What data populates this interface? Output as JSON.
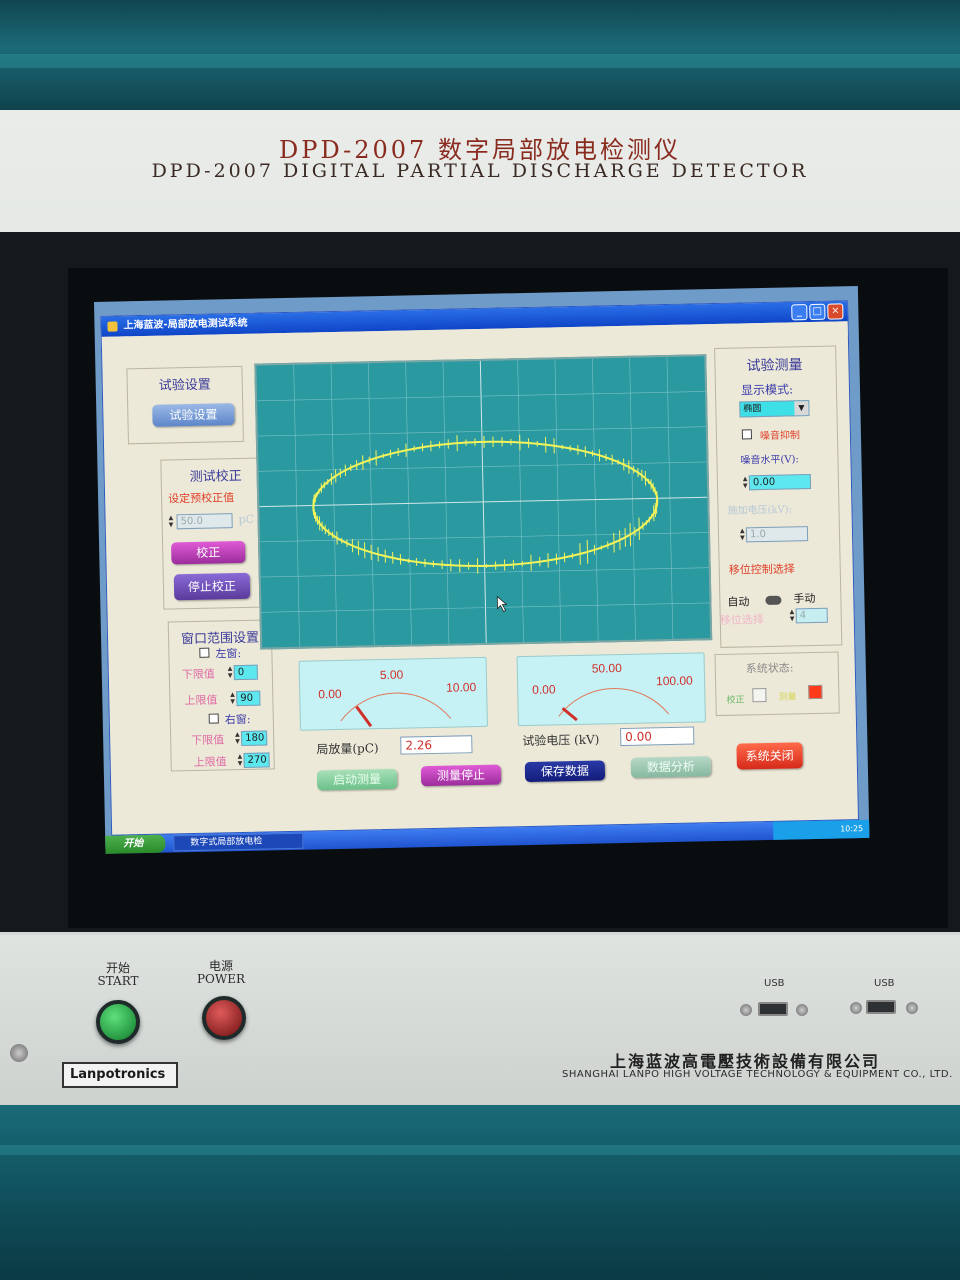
{
  "device": {
    "title_cn": "DPD-2007 数字局部放电检测仪",
    "title_en": "DPD-2007 DIGITAL PARTIAL DISCHARGE DETECTOR",
    "start_label_cn": "开始",
    "start_label_en": "START",
    "power_label_cn": "电源",
    "power_label_en": "POWER",
    "usb1": "USB",
    "usb2": "USB",
    "logo": "Lanpotronics",
    "company_cn": "上海蓝波高電壓技術設備有限公司",
    "company_en": "SHANGHAI LANPO HIGH VOLTAGE TECHNOLOGY & EQUIPMENT CO., LTD."
  },
  "window": {
    "title": "上海蓝波-局部放电测试系统"
  },
  "test_setup": {
    "title": "试验设置",
    "button": "试验设置"
  },
  "calibration": {
    "title": "测试校正",
    "preset_label": "设定预校正值",
    "preset_value": "50.0",
    "unit": "pC",
    "calibrate_button": "校正",
    "stop_button": "停止校正"
  },
  "window_range": {
    "title": "窗口范围设置",
    "left_window": "左窗:",
    "right_window": "右窗:",
    "lower_label": "下限值",
    "upper_label": "上限值",
    "left_lower": "0",
    "left_upper": "90",
    "right_lower": "180",
    "right_upper": "270"
  },
  "meters": {
    "pd": {
      "min": "0.00",
      "mid": "5.00",
      "max": "10.00",
      "label": "局放量(pC)",
      "value": "2.26",
      "level": 0.226
    },
    "voltage": {
      "min": "0.00",
      "mid": "50.00",
      "max": "100.00",
      "label": "试验电压 (kV)",
      "value": "0.00",
      "level": 0.0
    }
  },
  "bottom_buttons": {
    "start_measure": "启动测量",
    "stop_measure": "测量停止",
    "save_data": "保存数据",
    "analyze_data": "数据分析",
    "shutdown": "系统关闭"
  },
  "measurement": {
    "title": "试验测量",
    "display_mode_label": "显示模式:",
    "display_mode_value": "椭圆",
    "noise_suppress": "噪音抑制",
    "noise_level_label": "噪音水平(V):",
    "noise_level_value": "0.00",
    "applied_voltage_label": "施加电压(kV):",
    "applied_voltage_value": "1.0",
    "phase_control": "移位控制选择",
    "auto": "自动",
    "manual": "手动",
    "phase_select": "移位选择",
    "phase_value": "4",
    "status_title": "系统状态:",
    "status_calibrate": "校正",
    "status_measure": "测量"
  },
  "taskbar": {
    "start": "开始",
    "task": "数字式局部放电检",
    "time": "10:25"
  },
  "colors": {
    "scope_bg": "#2a9aa0",
    "trace": "#f4f45a",
    "accent_red": "#e0402a"
  }
}
